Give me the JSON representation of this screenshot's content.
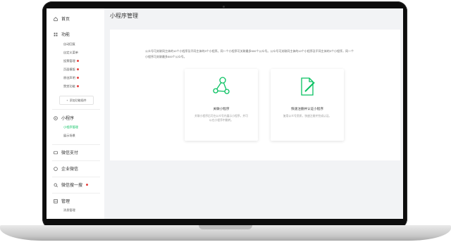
{
  "sidebar": {
    "home": "首页",
    "functions": {
      "label": "功能",
      "items": [
        {
          "label": "自动回复",
          "dot": false
        },
        {
          "label": "自定义菜单",
          "dot": false
        },
        {
          "label": "投票管理",
          "dot": true
        },
        {
          "label": "页面模版",
          "dot": true
        },
        {
          "label": "原创声明",
          "dot": true
        },
        {
          "label": "赞赏功能",
          "dot": true
        }
      ],
      "add_button": "添加功能插件"
    },
    "miniprogram": {
      "label": "小程序",
      "items": [
        {
          "label": "小程序管理",
          "active": true
        },
        {
          "label": "展示场景",
          "active": false
        }
      ]
    },
    "wechat_pay": "微信支付",
    "corp_wechat": "企业微信",
    "search": {
      "label": "微信搜一搜",
      "dot": true
    },
    "manage": {
      "label": "管理",
      "items": [
        {
          "label": "消息管理"
        }
      ]
    }
  },
  "main": {
    "title": "小程序管理",
    "description": "公众号可关联同主体的10个小程序及不同主体的3个小程序。同一个小程序可关联最多500个公众号。公众号可关联同主体的10个小程序及不同主体的3个小程序，同一个小程序可关联最多500个公众号。",
    "options": [
      {
        "title": "关联小程序",
        "desc": "关联小程序后可在公众号内展示小程序，并可以在小程序中跳转。",
        "icon": "share-nodes-icon"
      },
      {
        "title": "快速注册并认证小程序",
        "desc": "复用公众号资质，快速注册并完成认证。",
        "icon": "edit-document-icon"
      }
    ]
  },
  "colors": {
    "accent": "#07c160",
    "badge": "#e64340"
  }
}
